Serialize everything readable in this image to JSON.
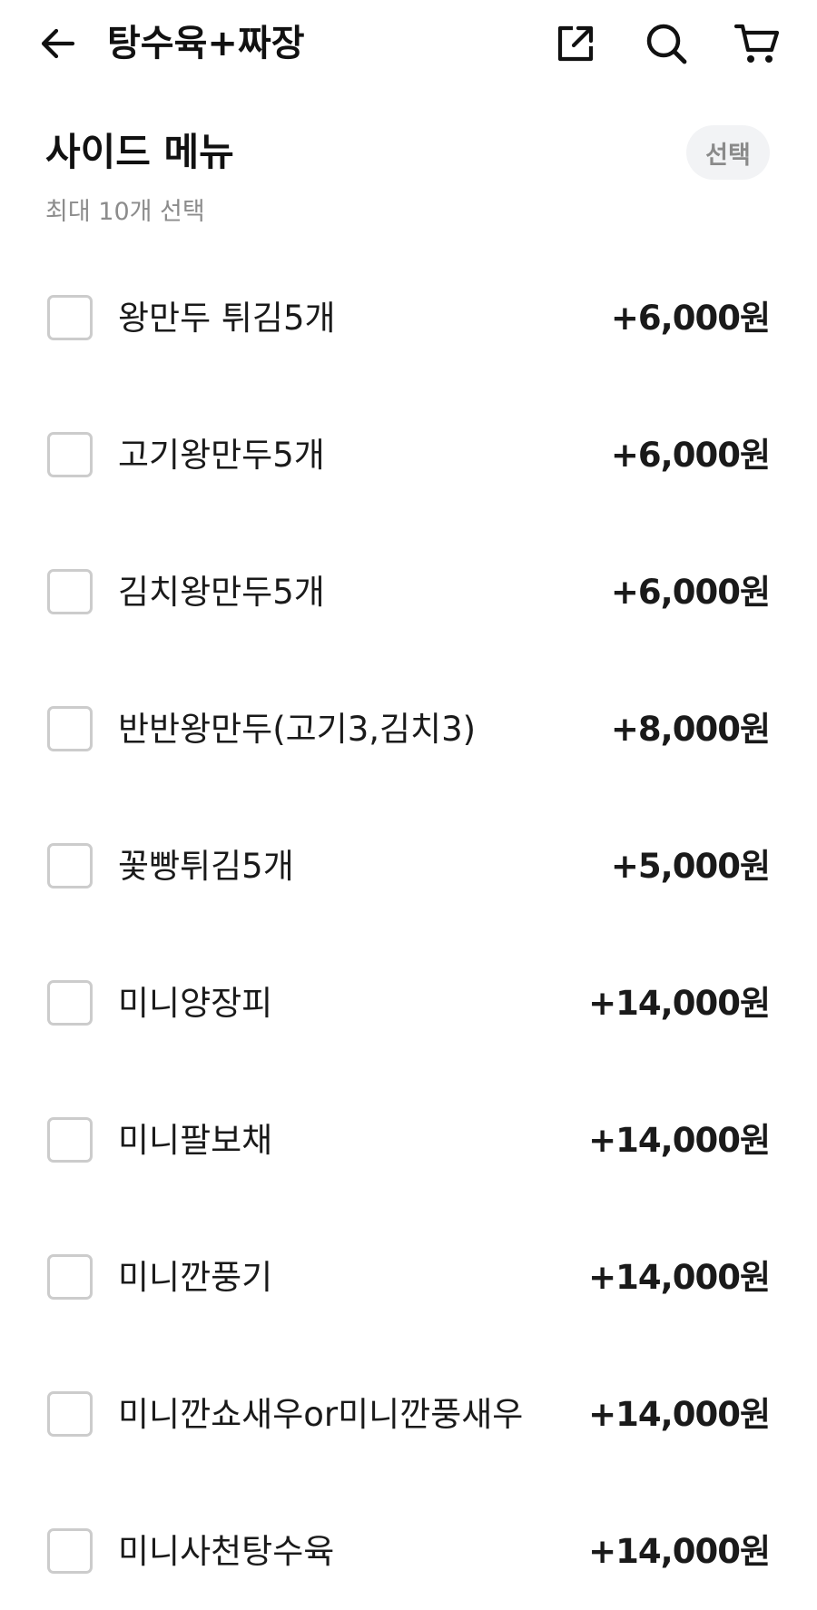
{
  "header": {
    "title": "탕수육+짜장",
    "icons": {
      "back": "arrow-left-icon",
      "share": "share-icon",
      "search": "search-icon",
      "cart": "cart-icon"
    }
  },
  "section": {
    "title": "사이드 메뉴",
    "badge": "선택",
    "subtitle": "최대 10개 선택"
  },
  "items": [
    {
      "name": "왕만두 튀김5개",
      "price": "+6,000원"
    },
    {
      "name": "고기왕만두5개",
      "price": "+6,000원"
    },
    {
      "name": "김치왕만두5개",
      "price": "+6,000원"
    },
    {
      "name": "반반왕만두(고기3,김치3)",
      "price": "+8,000원"
    },
    {
      "name": "꽃빵튀김5개",
      "price": "+5,000원"
    },
    {
      "name": "미니양장피",
      "price": "+14,000원"
    },
    {
      "name": "미니팔보채",
      "price": "+14,000원"
    },
    {
      "name": "미니깐풍기",
      "price": "+14,000원"
    },
    {
      "name": "미니깐쇼새우or미니깐풍새우",
      "price": "+14,000원"
    },
    {
      "name": "미니사천탕수육",
      "price": "+14,000원"
    }
  ],
  "colors": {
    "text": "#111111",
    "muted": "#8c8c8c",
    "checkbox_border": "#cccccc",
    "badge_bg": "#f2f3f5"
  }
}
